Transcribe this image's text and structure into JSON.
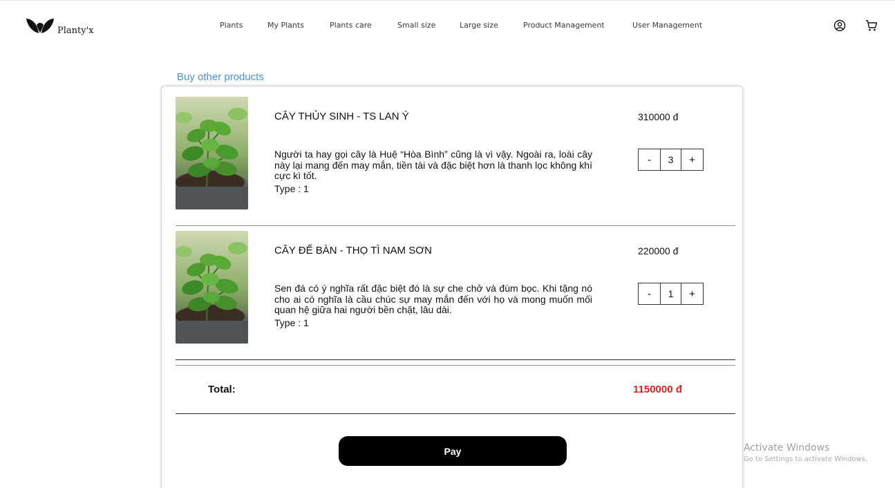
{
  "brand": {
    "name": "Planty'x"
  },
  "nav": {
    "items": [
      {
        "label": "Plants"
      },
      {
        "label": "My Plants"
      },
      {
        "label": "Plants care"
      },
      {
        "label": "Small size"
      },
      {
        "label": "Large size"
      },
      {
        "label": "Product Management"
      },
      {
        "label": "User Management"
      }
    ]
  },
  "header_icons": [
    "user-circle-icon",
    "shopping-cart-icon"
  ],
  "cart": {
    "buy_other_label": "Buy other products",
    "items": [
      {
        "name": "CÂY THỦY SINH - TS LAN Ý",
        "price": "310000 đ",
        "description": "Người ta hay gọi cây là Huệ “Hòa Bình” cũng là vì vậy. Ngoài ra, loài cây này lại mang đến may mắn, tiền tài và đặc biệt hơn là thanh lọc không khí cực kì tốt.",
        "type": "Type : 1",
        "quantity": "3",
        "minus_label": "-",
        "plus_label": "+",
        "image": "mint-plant-photo"
      },
      {
        "name": "CÂY ĐỂ BÀN - THỌ TÌ NAM SƠN",
        "price": "220000 đ",
        "description": "Sen đá có ý nghĩa rất đặc biệt đó là sự che chở và đùm bọc. Khi tặng nó cho ai có nghĩa là cầu chúc sự may mắn đến với họ và mong muốn mối quan hệ giữa hai người bền chặt, lâu dài.",
        "type": "Type : 1",
        "quantity": "1",
        "minus_label": "-",
        "plus_label": "+",
        "image": "mint-plant-photo"
      }
    ],
    "total_label": "Total:",
    "total_value": "1150000 đ",
    "pay_label": "Pay"
  },
  "watermark": {
    "title": "Activate Windows",
    "subtitle": "Go to Settings to activate Windows."
  },
  "colors": {
    "link": "#4a90e2",
    "total": "#e02020",
    "pay_button": "#000000"
  }
}
